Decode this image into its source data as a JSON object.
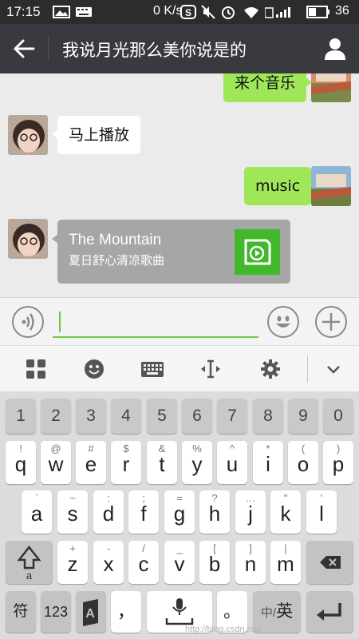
{
  "status_bar": {
    "time": "17:15",
    "net_speed": "0 K/s",
    "battery_level": "36"
  },
  "title_bar": {
    "title": "我说月光那么美你说是的"
  },
  "messages": [
    {
      "side": "right",
      "text": "来个音乐"
    },
    {
      "side": "left",
      "text": "马上播放"
    },
    {
      "side": "right",
      "text": "music"
    }
  ],
  "music_card": {
    "title": "The Mountain",
    "subtitle": "夏日舒心清凉歌曲",
    "accent": "#41b82c"
  },
  "input": {
    "value": ""
  },
  "keyboard": {
    "numbers": [
      "1",
      "2",
      "3",
      "4",
      "5",
      "6",
      "7",
      "8",
      "9",
      "0"
    ],
    "row1": [
      {
        "main": "q",
        "sub": "!"
      },
      {
        "main": "w",
        "sub": "@"
      },
      {
        "main": "e",
        "sub": "#"
      },
      {
        "main": "r",
        "sub": "$"
      },
      {
        "main": "t",
        "sub": "&"
      },
      {
        "main": "y",
        "sub": "%"
      },
      {
        "main": "u",
        "sub": "^"
      },
      {
        "main": "i",
        "sub": "*"
      },
      {
        "main": "o",
        "sub": "("
      },
      {
        "main": "p",
        "sub": ")"
      }
    ],
    "row2": [
      {
        "main": "a",
        "sub": "`"
      },
      {
        "main": "s",
        "sub": "~"
      },
      {
        "main": "d",
        "sub": ":"
      },
      {
        "main": "f",
        "sub": ";"
      },
      {
        "main": "g",
        "sub": "="
      },
      {
        "main": "h",
        "sub": "?"
      },
      {
        "main": "j",
        "sub": "…"
      },
      {
        "main": "k",
        "sub": "\""
      },
      {
        "main": "l",
        "sub": "'"
      }
    ],
    "row3": [
      {
        "main": "z",
        "sub": "+"
      },
      {
        "main": "x",
        "sub": "-"
      },
      {
        "main": "c",
        "sub": "/"
      },
      {
        "main": "v",
        "sub": "_"
      },
      {
        "main": "b",
        "sub": "["
      },
      {
        "main": "n",
        "sub": "]"
      },
      {
        "main": "m",
        "sub": "|"
      }
    ],
    "sym_label": "符",
    "num_label": "123",
    "comma_label": "，",
    "period_label": "。",
    "lang_label_small": "中/",
    "lang_label_big": "英"
  },
  "watermark": "http://blog.csdn.net/"
}
